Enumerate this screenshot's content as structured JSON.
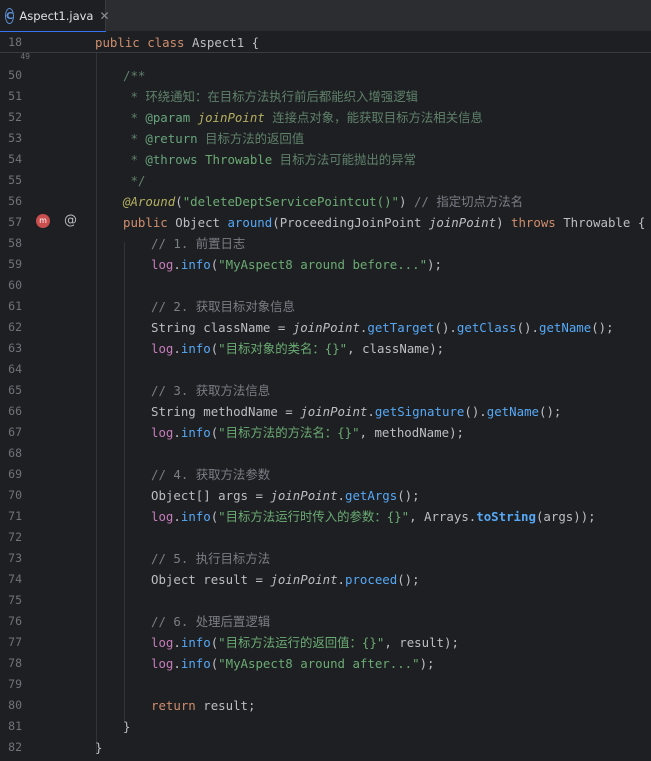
{
  "tab": {
    "label": "Aspect1.java",
    "close": "✕",
    "icon": "C"
  },
  "sticky": {
    "num": "18",
    "text": "public class Aspect1 {"
  },
  "lines": [
    {
      "n": "50"
    },
    {
      "n": "51"
    },
    {
      "n": "52"
    },
    {
      "n": "53"
    },
    {
      "n": "54"
    },
    {
      "n": "55"
    },
    {
      "n": "56"
    },
    {
      "n": "57"
    },
    {
      "n": "58"
    },
    {
      "n": "59"
    },
    {
      "n": "60"
    },
    {
      "n": "61"
    },
    {
      "n": "62"
    },
    {
      "n": "63"
    },
    {
      "n": "64"
    },
    {
      "n": "65"
    },
    {
      "n": "66"
    },
    {
      "n": "67"
    },
    {
      "n": "68"
    },
    {
      "n": "69"
    },
    {
      "n": "70"
    },
    {
      "n": "71"
    },
    {
      "n": "72"
    },
    {
      "n": "73"
    },
    {
      "n": "74"
    },
    {
      "n": "75"
    },
    {
      "n": "76"
    },
    {
      "n": "77"
    },
    {
      "n": "78"
    },
    {
      "n": "79"
    },
    {
      "n": "80"
    },
    {
      "n": "81"
    },
    {
      "n": "82"
    }
  ],
  "code": {
    "l50": "/**",
    "l51_star": " * ",
    "l51_text": "环绕通知：在目标方法执行前后都能织入增强逻辑",
    "l52_tag": "@param",
    "l52_name": "joinPoint",
    "l52_text": " 连接点对象，能获取目标方法相关信息",
    "l53_tag": "@return",
    "l53_text": " 目标方法的返回值",
    "l54_tag": "@throws",
    "l54_name": "Throwable",
    "l54_text": " 目标方法可能抛出的异常",
    "l55": " */",
    "l56_ann": "@Around",
    "l56_str": "\"deleteDeptServicePointcut()\"",
    "l56_cmt": "// 指定切点方法名",
    "l57_public": "public",
    "l57_type": "Object",
    "l57_fn": "around",
    "l57_ptype": "ProceedingJoinPoint",
    "l57_param": "joinPoint",
    "l57_throws": "throws",
    "l57_ex": "Throwable",
    "l58": "// 1. 前置日志",
    "log": "log",
    "info": "info",
    "l59_str": "\"MyAspect8 around before...\"",
    "l61": "// 2. 获取目标对象信息",
    "l62_type": "String",
    "l62_var": "className",
    "jp": "joinPoint",
    "getTarget": "getTarget",
    "getClass": "getClass",
    "getName": "getName",
    "l63_str": "\"目标对象的类名：{}\"",
    "l63_arg": "className",
    "l65": "// 3. 获取方法信息",
    "l66_var": "methodName",
    "getSignature": "getSignature",
    "l67_str": "\"目标方法的方法名：{}\"",
    "l67_arg": "methodName",
    "l69": "// 4. 获取方法参数",
    "l70_type": "Object[]",
    "l70_var": "args",
    "getArgs": "getArgs",
    "l71_str": "\"目标方法运行时传入的参数：{}\"",
    "l71_cls": "Arrays",
    "toString": "toString",
    "l71_arg": "args",
    "l73": "// 5. 执行目标方法",
    "l74_type": "Object",
    "l74_var": "result",
    "proceed": "proceed",
    "l76": "// 6. 处理后置逻辑",
    "l77_str": "\"目标方法运行的返回值：{}\"",
    "l77_arg": "result",
    "l78_str": "\"MyAspect8 around after...\"",
    "l80_kw": "return",
    "l80_var": "result",
    "close_brace": "}"
  },
  "gutter_icons": {
    "method_icon": "m",
    "annotation_icon": "@"
  },
  "colors": {
    "background": "#1e1f22",
    "keyword": "#cf8e6d",
    "string": "#6aab73",
    "comment": "#7a7e85",
    "function": "#56a8f5",
    "field": "#c77dbb",
    "annotation": "#b3ae60",
    "doc_tag": "#67a37c"
  }
}
